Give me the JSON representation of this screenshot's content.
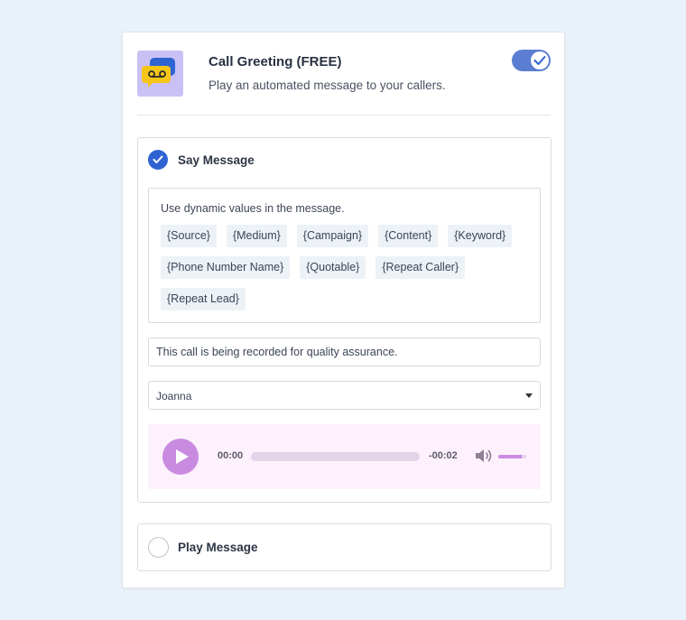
{
  "header": {
    "title": "Call Greeting (FREE)",
    "subtitle": "Play an automated message to your callers.",
    "icon": "voicemail-chat-icon",
    "enabled": true
  },
  "say_message": {
    "label": "Say Message",
    "selected": true,
    "dynamic_values": {
      "prompt": "Use dynamic values in the message.",
      "tags": [
        "{Source}",
        "{Medium}",
        "{Campaign}",
        "{Content}",
        "{Keyword}",
        "{Phone Number Name}",
        "{Quotable}",
        "{Repeat Caller}",
        "{Repeat Lead}"
      ]
    },
    "message_text": "This call is being recorded for quality assurance.",
    "voice": "Joanna",
    "player": {
      "current_time": "00:00",
      "remaining_time": "-00:02",
      "progress": 0,
      "volume": 0.85
    }
  },
  "play_message": {
    "label": "Play Message",
    "selected": false
  },
  "colors": {
    "background": "#e9f1fa",
    "toggle_on": "#5b7ed3",
    "radio_selected": "#2f63d2",
    "player_background": "#fdf1fd",
    "player_accent": "#c98be0",
    "icon_background": "#c9c1f5"
  }
}
